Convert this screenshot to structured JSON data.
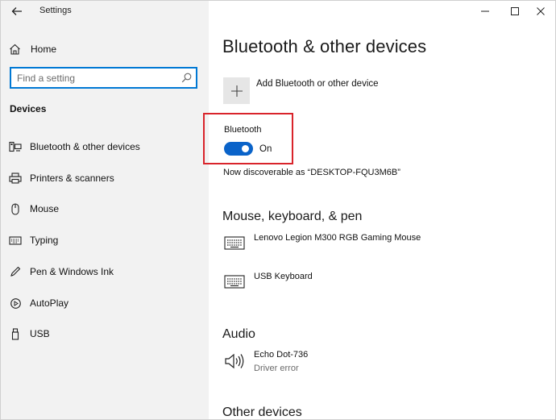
{
  "window": {
    "title": "Settings",
    "back_icon": "arrow-left-icon",
    "controls": [
      "minimize-icon",
      "maximize-icon",
      "close-icon"
    ]
  },
  "sidebar": {
    "home_label": "Home",
    "search_placeholder": "Find a setting",
    "section_title": "Devices",
    "items": [
      {
        "label": "Bluetooth & other devices",
        "icon": "devices-icon"
      },
      {
        "label": "Printers & scanners",
        "icon": "printer-icon"
      },
      {
        "label": "Mouse",
        "icon": "mouse-icon"
      },
      {
        "label": "Typing",
        "icon": "keyboard-icon"
      },
      {
        "label": "Pen & Windows Ink",
        "icon": "pen-icon"
      },
      {
        "label": "AutoPlay",
        "icon": "autoplay-icon"
      },
      {
        "label": "USB",
        "icon": "usb-icon"
      }
    ]
  },
  "main": {
    "title": "Bluetooth & other devices",
    "add_label": "Add Bluetooth or other device",
    "bluetooth": {
      "label": "Bluetooth",
      "state": "On",
      "on": true,
      "discoverable_text": "Now discoverable as “DESKTOP-FQU3M6B”"
    },
    "sections": [
      {
        "heading": "Mouse, keyboard, & pen",
        "devices": [
          {
            "name": "Lenovo Legion M300 RGB Gaming Mouse",
            "icon": "keyboard-icon"
          },
          {
            "name": "USB Keyboard",
            "icon": "keyboard-icon"
          }
        ]
      },
      {
        "heading": "Audio",
        "devices": [
          {
            "name": "Echo Dot-736",
            "status": "Driver error",
            "icon": "speaker-icon"
          }
        ]
      },
      {
        "heading": "Other devices",
        "devices": []
      }
    ]
  },
  "colors": {
    "accent": "#0a63c9",
    "highlight": "#d9242b",
    "sidebar_bg": "#f2f2f2"
  }
}
